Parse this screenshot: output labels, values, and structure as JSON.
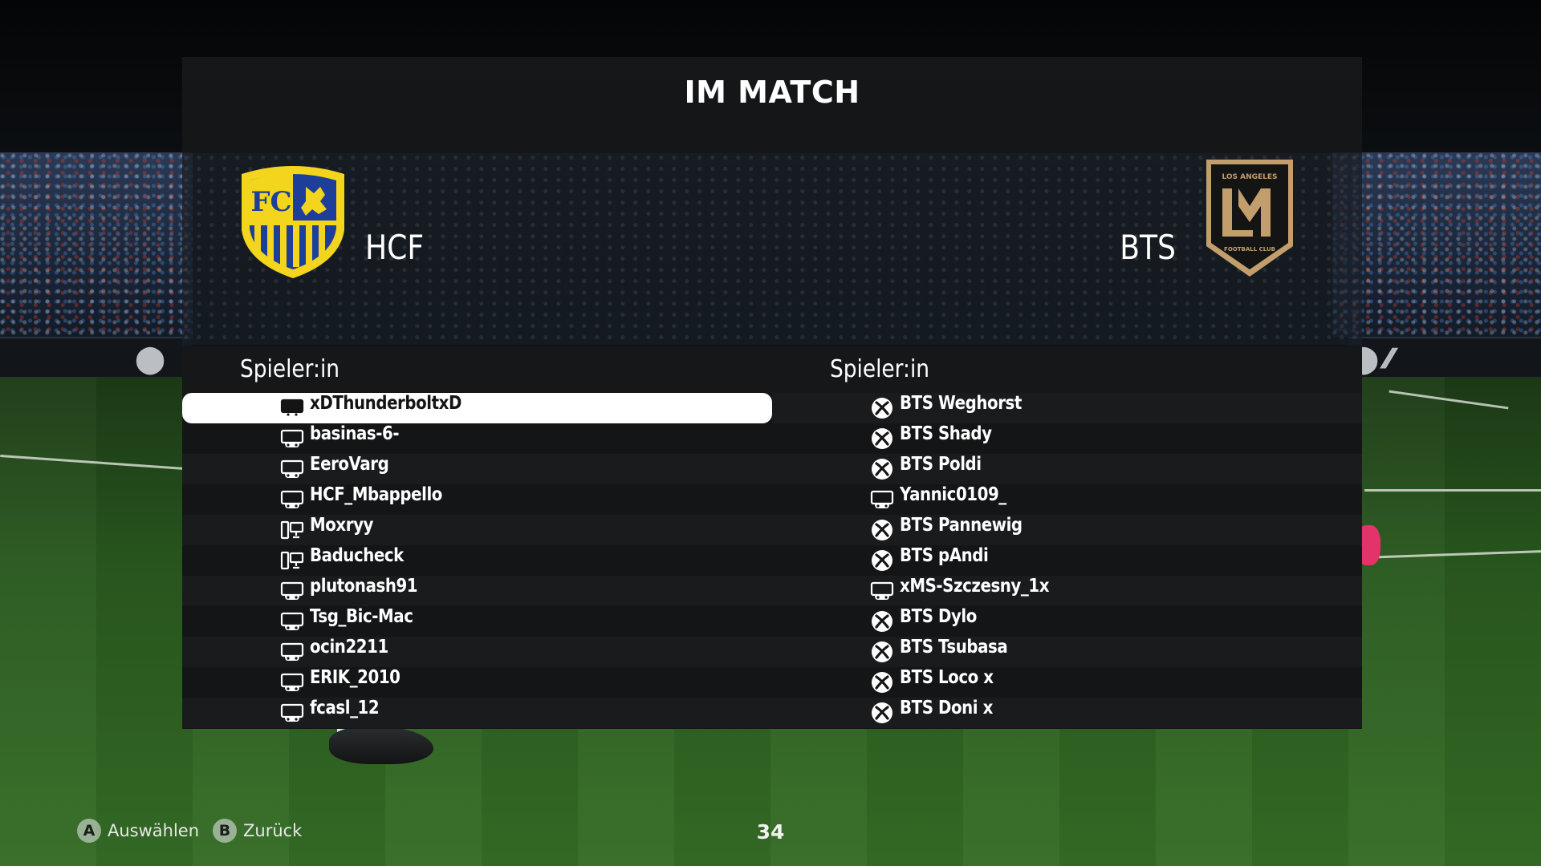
{
  "screen": {
    "title": "IM MATCH"
  },
  "home_team": {
    "abbr": "HCF",
    "crest_text": "FC",
    "colors": {
      "primary": "#1d3f9a",
      "secondary": "#f2d51c"
    },
    "column_header": "Spieler:in",
    "players": [
      {
        "name": "xDThunderboltxD",
        "platform_icon": "console-icon",
        "selected": true
      },
      {
        "name": "basinas-6-",
        "platform_icon": "console-icon"
      },
      {
        "name": "EeroVarg",
        "platform_icon": "console-icon"
      },
      {
        "name": "HCF_Mbappello",
        "platform_icon": "console-icon"
      },
      {
        "name": "Moxryy",
        "platform_icon": "pc-icon"
      },
      {
        "name": "Baducheck",
        "platform_icon": "pc-icon"
      },
      {
        "name": "plutonash91",
        "platform_icon": "console-icon"
      },
      {
        "name": "Tsg_Bic-Mac",
        "platform_icon": "console-icon"
      },
      {
        "name": "ocin2211",
        "platform_icon": "console-icon"
      },
      {
        "name": "ERIK_2010",
        "platform_icon": "console-icon"
      },
      {
        "name": "fcasl_12",
        "platform_icon": "console-icon"
      }
    ]
  },
  "away_team": {
    "abbr": "BTS",
    "crest_text_top": "LOS ANGELES",
    "crest_text_bottom": "FOOTBALL CLUB",
    "colors": {
      "primary": "#141414",
      "secondary": "#c39e6d"
    },
    "column_header": "Spieler:in",
    "players": [
      {
        "name": "BTS Weghorst",
        "platform_icon": "xbox-icon"
      },
      {
        "name": "BTS Shady",
        "platform_icon": "xbox-icon"
      },
      {
        "name": "BTS Poldi",
        "platform_icon": "xbox-icon"
      },
      {
        "name": "Yannic0109_",
        "platform_icon": "console-icon"
      },
      {
        "name": "BTS Pannewig",
        "platform_icon": "xbox-icon"
      },
      {
        "name": "BTS pAndi",
        "platform_icon": "xbox-icon"
      },
      {
        "name": "xMS-Szczesny_1x",
        "platform_icon": "console-icon"
      },
      {
        "name": "BTS Dylo",
        "platform_icon": "xbox-icon"
      },
      {
        "name": "BTS Tsubasa",
        "platform_icon": "xbox-icon"
      },
      {
        "name": "BTS Loco x",
        "platform_icon": "xbox-icon"
      },
      {
        "name": "BTS Doni x",
        "platform_icon": "xbox-icon"
      }
    ]
  },
  "footer": {
    "select_button_glyph": "A",
    "select_label": "Auswählen",
    "back_button_glyph": "B",
    "back_label": "Zurück",
    "timer": "34"
  }
}
